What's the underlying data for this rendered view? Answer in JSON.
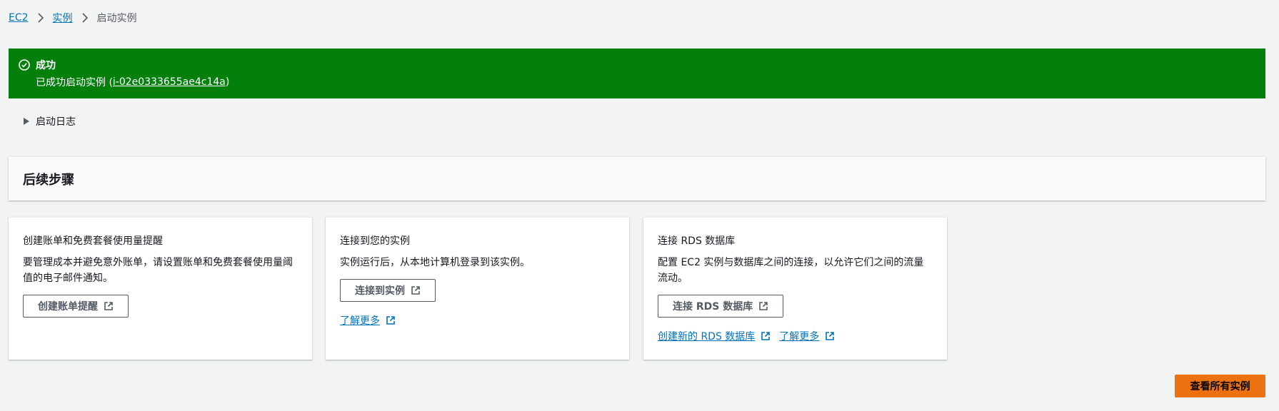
{
  "breadcrumb": {
    "items": [
      {
        "label": "EC2"
      },
      {
        "label": "实例"
      }
    ],
    "current": "启动实例"
  },
  "flash": {
    "type": "success",
    "title": "成功",
    "message_prefix": "已成功启动实例 (",
    "instance_id": "i-02e0333655ae4c14a",
    "message_suffix": ")",
    "icon": "check-circle-icon",
    "color": "#037f0c"
  },
  "launch_log": {
    "label": "启动日志",
    "icon": "caret-right-icon"
  },
  "next_steps": {
    "title": "后续步骤",
    "cards": [
      {
        "title": "创建账单和免费套餐使用量提醒",
        "description": "要管理成本并避免意外账单，请设置账单和免费套餐使用量阈值的电子邮件通知。",
        "button_label": "创建账单提醒"
      },
      {
        "title": "连接到您的实例",
        "description": "实例运行后，从本地计算机登录到该实例。",
        "button_label": "连接到实例",
        "link_label": "了解更多"
      },
      {
        "title": "连接 RDS 数据库",
        "description": "配置 EC2 实例与数据库之间的连接，以允许它们之间的流量流动。",
        "button_label": "连接 RDS 数据库",
        "link1_label": "创建新的 RDS 数据库",
        "link2_label": "了解更多"
      }
    ]
  },
  "primary_button": {
    "label": "查看所有实例",
    "color": "#ec7211"
  },
  "colors": {
    "link": "#0073bb",
    "background": "#f2f3f3",
    "text": "#16191f"
  }
}
